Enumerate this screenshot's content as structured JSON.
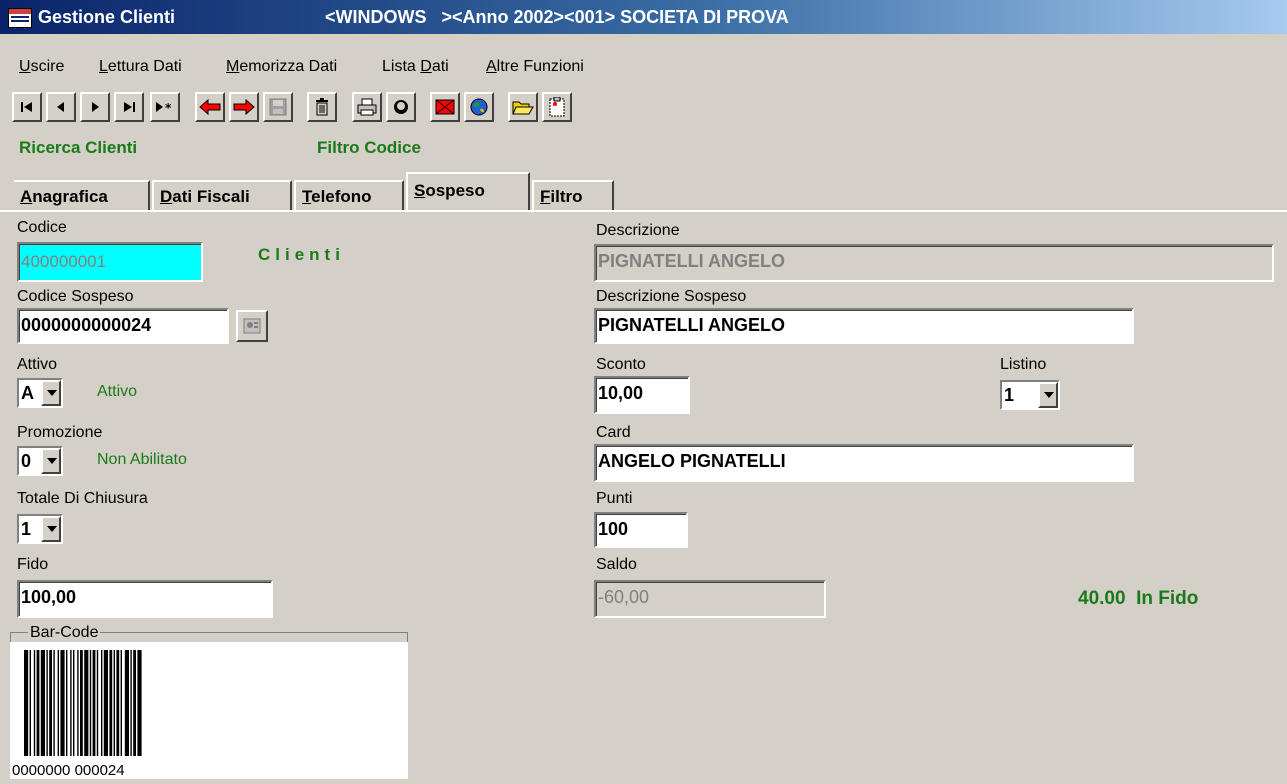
{
  "window": {
    "app_title": "Gestione Clienti",
    "context": "<WINDOWS   ><Anno 2002><001> SOCIETA DI PROVA"
  },
  "menu": [
    {
      "label": "Uscire",
      "hotkey": "U"
    },
    {
      "label": "Lettura Dati",
      "hotkey": "L"
    },
    {
      "label": "Memorizza Dati",
      "hotkey": "M"
    },
    {
      "label": "Lista Dati",
      "hotkey": "D"
    },
    {
      "label": "Altre Funzioni",
      "hotkey": "A"
    }
  ],
  "toolbar": {
    "icons": [
      "first-record-icon",
      "previous-record-icon",
      "next-record-icon",
      "last-record-icon",
      "new-record-icon",
      "undo-arrow-icon",
      "redo-arrow-icon",
      "save-disk-icon",
      "trash-icon",
      "printer-icon",
      "user-face-icon",
      "mail-icon",
      "globe-icon",
      "open-folder-icon",
      "clipboard-icon"
    ],
    "accent_red": "#ff0000"
  },
  "status": {
    "search_label": "Ricerca Clienti",
    "filter_label": "Filtro Codice",
    "color": "#1a7a1a"
  },
  "tabs": [
    {
      "label": "Anagrafica",
      "active": false
    },
    {
      "label": "Dati Fiscali",
      "active": false
    },
    {
      "label": "Telefono",
      "active": false
    },
    {
      "label": "Sospeso",
      "active": true
    },
    {
      "label": "Filtro",
      "active": false
    }
  ],
  "form": {
    "codice": {
      "label": "Codice",
      "value": "400000001"
    },
    "clienti_caption": "Clienti",
    "descrizione": {
      "label": "Descrizione",
      "value": "PIGNATELLI ANGELO"
    },
    "codice_sospeso": {
      "label": "Codice Sospeso",
      "value": "0000000000024"
    },
    "descrizione_sospeso": {
      "label": "Descrizione Sospeso",
      "value": "PIGNATELLI ANGELO"
    },
    "attivo": {
      "label": "Attivo",
      "value": "A",
      "caption": "Attivo"
    },
    "sconto": {
      "label": "Sconto",
      "value": "10,00"
    },
    "listino": {
      "label": "Listino",
      "value": "1"
    },
    "promozione": {
      "label": "Promozione",
      "value": "0",
      "caption": "Non Abilitato"
    },
    "card": {
      "label": "Card",
      "value": "ANGELO PIGNATELLI"
    },
    "totale_chiusura": {
      "label": "Totale Di Chiusura",
      "value": "1"
    },
    "punti": {
      "label": "Punti",
      "value": "100"
    },
    "fido": {
      "label": "Fido",
      "value": "100,00"
    },
    "saldo": {
      "label": "Saldo",
      "value": "-60,00"
    },
    "fido_status": "40.00  In Fido"
  },
  "barcode": {
    "legend": "Bar-Code",
    "text": "0000000 000024"
  }
}
